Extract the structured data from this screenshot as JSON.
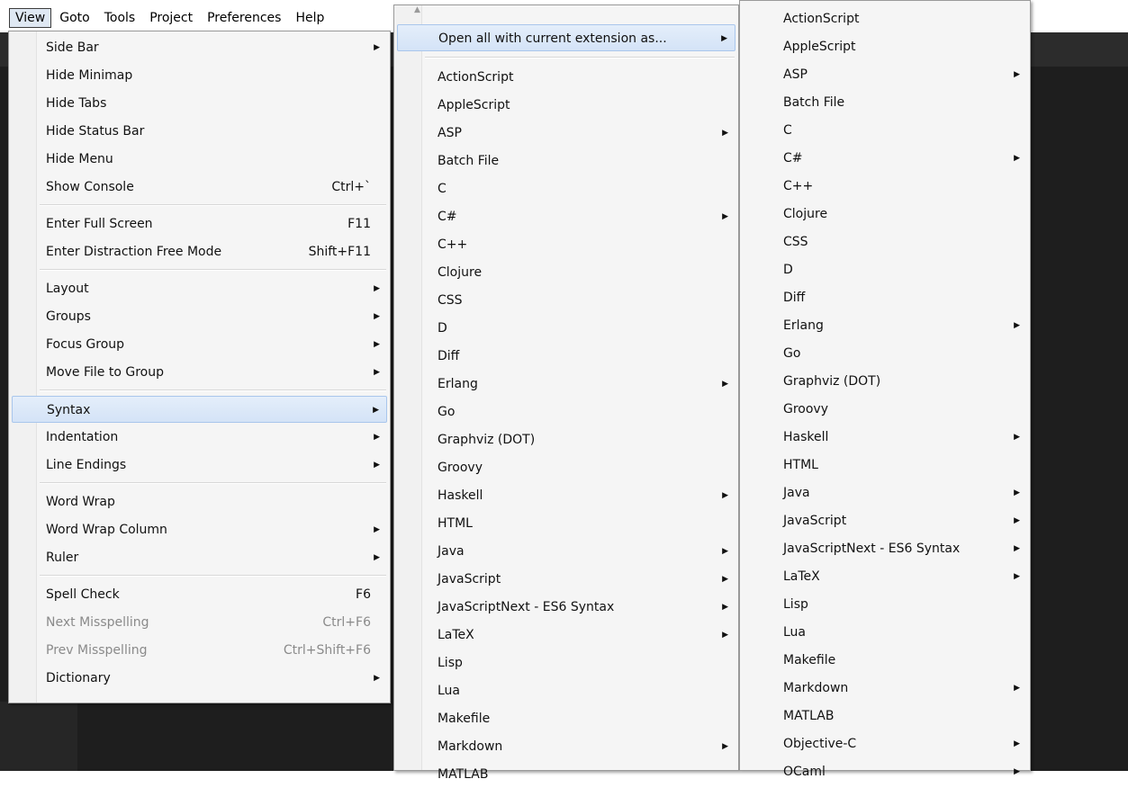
{
  "menubar": {
    "items": [
      "View",
      "Goto",
      "Tools",
      "Project",
      "Preferences",
      "Help"
    ]
  },
  "view_menu": {
    "items": [
      {
        "label": "Side Bar",
        "shortcut": "",
        "submenu": true,
        "disabled": false
      },
      {
        "label": "Hide Minimap",
        "shortcut": "",
        "submenu": false,
        "disabled": false
      },
      {
        "label": "Hide Tabs",
        "shortcut": "",
        "submenu": false,
        "disabled": false
      },
      {
        "label": "Hide Status Bar",
        "shortcut": "",
        "submenu": false,
        "disabled": false
      },
      {
        "label": "Hide Menu",
        "shortcut": "",
        "submenu": false,
        "disabled": false
      },
      {
        "label": "Show Console",
        "shortcut": "Ctrl+`",
        "submenu": false,
        "disabled": false
      },
      {
        "label": "Enter Full Screen",
        "shortcut": "F11",
        "submenu": false,
        "disabled": false
      },
      {
        "label": "Enter Distraction Free Mode",
        "shortcut": "Shift+F11",
        "submenu": false,
        "disabled": false
      },
      {
        "label": "Layout",
        "shortcut": "",
        "submenu": true,
        "disabled": false
      },
      {
        "label": "Groups",
        "shortcut": "",
        "submenu": true,
        "disabled": false
      },
      {
        "label": "Focus Group",
        "shortcut": "",
        "submenu": true,
        "disabled": false
      },
      {
        "label": "Move File to Group",
        "shortcut": "",
        "submenu": true,
        "disabled": false
      },
      {
        "label": "Syntax",
        "shortcut": "",
        "submenu": true,
        "disabled": false,
        "highlighted": true
      },
      {
        "label": "Indentation",
        "shortcut": "",
        "submenu": true,
        "disabled": false
      },
      {
        "label": "Line Endings",
        "shortcut": "",
        "submenu": true,
        "disabled": false
      },
      {
        "label": "Word Wrap",
        "shortcut": "",
        "submenu": false,
        "disabled": false
      },
      {
        "label": "Word Wrap Column",
        "shortcut": "",
        "submenu": true,
        "disabled": false
      },
      {
        "label": "Ruler",
        "shortcut": "",
        "submenu": true,
        "disabled": false
      },
      {
        "label": "Spell Check",
        "shortcut": "F6",
        "submenu": false,
        "disabled": false
      },
      {
        "label": "Next Misspelling",
        "shortcut": "Ctrl+F6",
        "submenu": false,
        "disabled": true
      },
      {
        "label": "Prev Misspelling",
        "shortcut": "Ctrl+Shift+F6",
        "submenu": false,
        "disabled": true
      },
      {
        "label": "Dictionary",
        "shortcut": "",
        "submenu": true,
        "disabled": false
      }
    ]
  },
  "syntax_menu": {
    "open_all_label": "Open all with current extension as...",
    "items": [
      {
        "label": "ActionScript",
        "submenu": false
      },
      {
        "label": "AppleScript",
        "submenu": false
      },
      {
        "label": "ASP",
        "submenu": true
      },
      {
        "label": "Batch File",
        "submenu": false
      },
      {
        "label": "C",
        "submenu": false
      },
      {
        "label": "C#",
        "submenu": true
      },
      {
        "label": "C++",
        "submenu": false
      },
      {
        "label": "Clojure",
        "submenu": false
      },
      {
        "label": "CSS",
        "submenu": false
      },
      {
        "label": "D",
        "submenu": false
      },
      {
        "label": "Diff",
        "submenu": false
      },
      {
        "label": "Erlang",
        "submenu": true
      },
      {
        "label": "Go",
        "submenu": false
      },
      {
        "label": "Graphviz (DOT)",
        "submenu": false
      },
      {
        "label": "Groovy",
        "submenu": false
      },
      {
        "label": "Haskell",
        "submenu": true
      },
      {
        "label": "HTML",
        "submenu": false
      },
      {
        "label": "Java",
        "submenu": true
      },
      {
        "label": "JavaScript",
        "submenu": true
      },
      {
        "label": "JavaScriptNext - ES6 Syntax",
        "submenu": true
      },
      {
        "label": "LaTeX",
        "submenu": true
      },
      {
        "label": "Lisp",
        "submenu": false
      },
      {
        "label": "Lua",
        "submenu": false
      },
      {
        "label": "Makefile",
        "submenu": false
      },
      {
        "label": "Markdown",
        "submenu": true
      },
      {
        "label": "MATLAB",
        "submenu": false
      }
    ]
  },
  "extension_menu": {
    "items": [
      {
        "label": "ActionScript",
        "submenu": false
      },
      {
        "label": "AppleScript",
        "submenu": false
      },
      {
        "label": "ASP",
        "submenu": true
      },
      {
        "label": "Batch File",
        "submenu": false
      },
      {
        "label": "C",
        "submenu": false
      },
      {
        "label": "C#",
        "submenu": true
      },
      {
        "label": "C++",
        "submenu": false
      },
      {
        "label": "Clojure",
        "submenu": false
      },
      {
        "label": "CSS",
        "submenu": false
      },
      {
        "label": "D",
        "submenu": false
      },
      {
        "label": "Diff",
        "submenu": false
      },
      {
        "label": "Erlang",
        "submenu": true
      },
      {
        "label": "Go",
        "submenu": false
      },
      {
        "label": "Graphviz (DOT)",
        "submenu": false
      },
      {
        "label": "Groovy",
        "submenu": false
      },
      {
        "label": "Haskell",
        "submenu": true
      },
      {
        "label": "HTML",
        "submenu": false
      },
      {
        "label": "Java",
        "submenu": true
      },
      {
        "label": "JavaScript",
        "submenu": true
      },
      {
        "label": "JavaScriptNext - ES6 Syntax",
        "submenu": true
      },
      {
        "label": "LaTeX",
        "submenu": true
      },
      {
        "label": "Lisp",
        "submenu": false
      },
      {
        "label": "Lua",
        "submenu": false
      },
      {
        "label": "Makefile",
        "submenu": false
      },
      {
        "label": "Markdown",
        "submenu": true
      },
      {
        "label": "MATLAB",
        "submenu": false
      },
      {
        "label": "Objective-C",
        "submenu": true
      },
      {
        "label": "OCaml",
        "submenu": true
      }
    ]
  },
  "icons": {
    "submenu_arrow": "submenu-arrow-icon",
    "scroll_up": "scroll-up-arrow-icon"
  },
  "colors": {
    "highlight": "#d4e3f7",
    "highlight_border": "#a9c6ec",
    "menu_bg": "#f5f5f5",
    "disabled_text": "#8a8a8a",
    "editor_bg": "#1e1e1e"
  }
}
